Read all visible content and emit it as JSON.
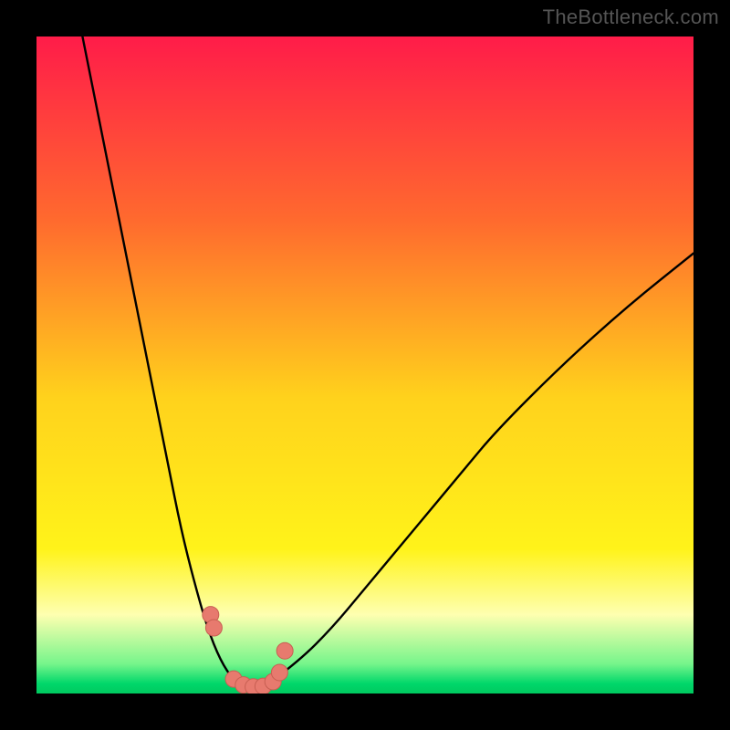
{
  "watermark": "TheBottleneck.com",
  "colors": {
    "black": "#000000",
    "curve": "#000000",
    "marker_fill": "#E77A6E",
    "marker_stroke": "#C75F52",
    "grad_top": "#FF1C49",
    "grad_mid1": "#FF6A2E",
    "grad_mid2": "#FFD21C",
    "grad_yellow": "#FFF31A",
    "grad_pale": "#FEFFB0",
    "grad_green": "#00D76A",
    "grad_green2": "#00C95F"
  },
  "chart_data": {
    "type": "line",
    "title": "",
    "xlabel": "",
    "ylabel": "",
    "xlim": [
      0,
      100
    ],
    "ylim": [
      0,
      100
    ],
    "note": "V-shaped bottleneck curve; x is a normalized component ratio (0–100), y is bottleneck (%) where 0 is optimal (bottom/green) and 100 is worst (top/red). Watermark from TheBottleneck.com.",
    "series": [
      {
        "name": "left-branch",
        "x": [
          7,
          10,
          15,
          20,
          22,
          24,
          26,
          28,
          30
        ],
        "y": [
          100,
          85,
          60,
          35,
          25,
          17,
          10,
          5,
          2
        ]
      },
      {
        "name": "right-branch",
        "x": [
          36,
          40,
          45,
          50,
          55,
          60,
          65,
          70,
          80,
          90,
          100
        ],
        "y": [
          2,
          5,
          10,
          16,
          22,
          28,
          34,
          40,
          50,
          59,
          67
        ]
      },
      {
        "name": "valley",
        "x": [
          30,
          31,
          32,
          33,
          34,
          35,
          36
        ],
        "y": [
          2,
          1,
          0.5,
          0.4,
          0.5,
          1,
          2
        ]
      }
    ],
    "markers": {
      "name": "highlighted-points",
      "x": [
        26.5,
        27,
        30,
        31.5,
        33,
        34.5,
        36,
        37,
        37.8
      ],
      "y": [
        12,
        10,
        2.2,
        1.3,
        1.0,
        1.1,
        1.8,
        3.2,
        6.5
      ]
    },
    "gradient_stops": [
      {
        "pos": 0.0,
        "color": "#FF1C49"
      },
      {
        "pos": 0.28,
        "color": "#FF6A2E"
      },
      {
        "pos": 0.55,
        "color": "#FFD21C"
      },
      {
        "pos": 0.78,
        "color": "#FFF31A"
      },
      {
        "pos": 0.88,
        "color": "#FEFFB0"
      },
      {
        "pos": 0.955,
        "color": "#76F58B"
      },
      {
        "pos": 0.985,
        "color": "#00D76A"
      },
      {
        "pos": 1.0,
        "color": "#00C95F"
      }
    ]
  }
}
